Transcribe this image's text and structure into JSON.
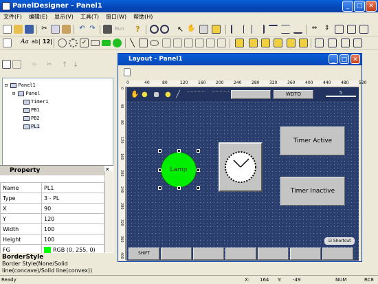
{
  "window": {
    "title": "PanelDesigner - Panel1"
  },
  "menu": [
    "文件(F)",
    "编辑(E)",
    "显示(V)",
    "工具(T)",
    "窗口(W)",
    "帮助(H)"
  ],
  "toolbar": {
    "run_label": "Run"
  },
  "tree": {
    "root": "Panel1",
    "child": "Panel",
    "items": [
      "Timer1",
      "PB1",
      "PB2",
      "PL1"
    ]
  },
  "property": {
    "title": "Property",
    "rows": [
      {
        "name": "Name",
        "value": "PL1"
      },
      {
        "name": "Type",
        "value": "3 - PL"
      },
      {
        "name": "X",
        "value": "90"
      },
      {
        "name": "Y",
        "value": "120"
      },
      {
        "name": "Width",
        "value": "100"
      },
      {
        "name": "Height",
        "value": "100"
      },
      {
        "name": "FG",
        "value": "RGB (0, 255, 0)"
      }
    ],
    "fg_color": "#00ff00",
    "help_title": "BorderStyle",
    "help_text": "Border Style(None/Solid line(concave)/Solid line(convex))"
  },
  "layout": {
    "title": "Layout - Panel1",
    "ruler_ticks": [
      "0",
      "40",
      "80",
      "120",
      "160",
      "200",
      "240",
      "280",
      "320",
      "360",
      "400",
      "440",
      "480",
      "520"
    ],
    "vruler_ticks": [
      "0",
      "40",
      "80",
      "120",
      "160",
      "200",
      "240",
      "280",
      "320",
      "360",
      "400"
    ],
    "wdt_label": "WDTO",
    "slider_value": "5",
    "lamp_label": "Lamp",
    "lamp_color": "#00ee00",
    "timer_active": "Timer Active",
    "timer_inactive": "Timer Inactive",
    "shortcut_label": "Shortcut",
    "shift_label": "SHIFT"
  },
  "status": {
    "left": "Ready",
    "x_label": "X:",
    "x_value": "164",
    "y_label": "Y:",
    "y_value": "-49",
    "num": "NUM",
    "zoom": "RC8"
  }
}
